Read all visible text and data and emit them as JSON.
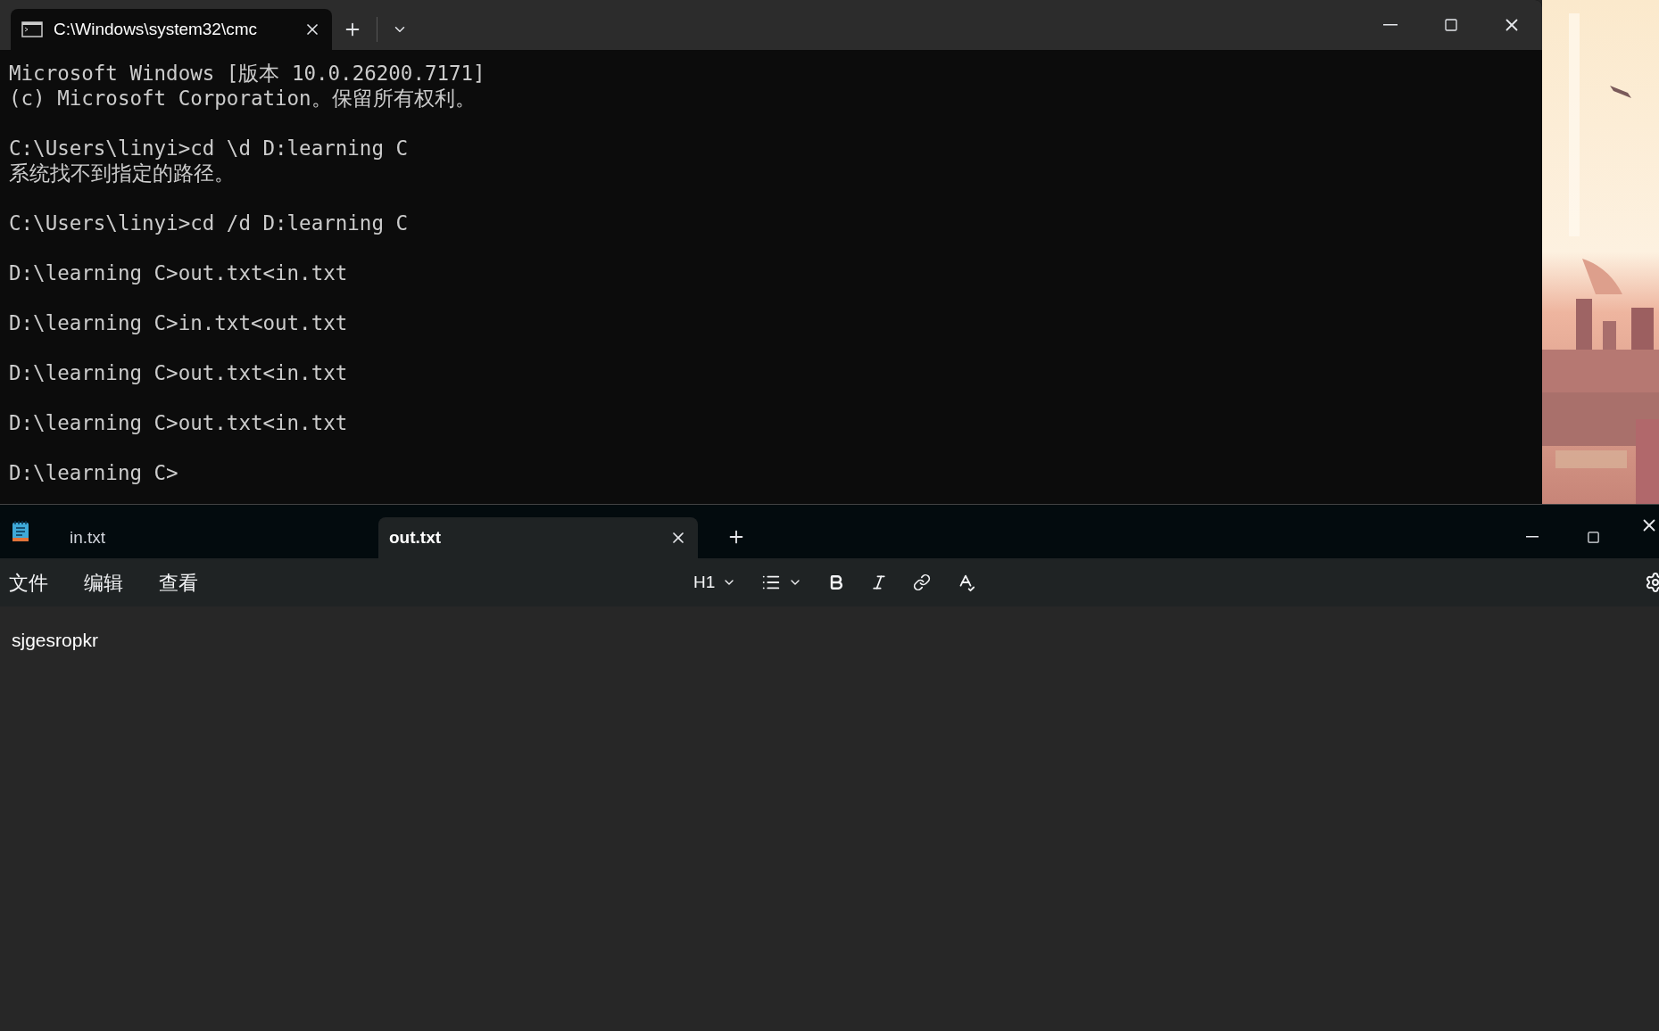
{
  "terminal": {
    "tab": {
      "title": "C:\\Windows\\system32\\cmc",
      "selected": true
    },
    "output": [
      {
        "lines": [
          "Microsoft Windows [版本 10.0.26200.7171]",
          "(c) Microsoft Corporation。保留所有权利。"
        ]
      },
      {
        "lines": [
          "C:\\Users\\linyi>cd \\d D:learning C",
          "系统找不到指定的路径。"
        ]
      },
      {
        "lines": [
          "C:\\Users\\linyi>cd /d D:learning C"
        ]
      },
      {
        "lines": [
          "D:\\learning C>out.txt<in.txt"
        ]
      },
      {
        "lines": [
          "D:\\learning C>in.txt<out.txt"
        ]
      },
      {
        "lines": [
          "D:\\learning C>out.txt<in.txt"
        ]
      },
      {
        "lines": [
          "D:\\learning C>out.txt<in.txt"
        ]
      },
      {
        "lines": [
          "D:\\learning C>"
        ]
      }
    ]
  },
  "notepad": {
    "tabs": [
      {
        "label": "in.txt",
        "selected": false
      },
      {
        "label": "out.txt",
        "selected": true
      }
    ],
    "menu": [
      "文件",
      "编辑",
      "查看"
    ],
    "heading_dropdown": "H1",
    "content": "sjgesropkr"
  }
}
